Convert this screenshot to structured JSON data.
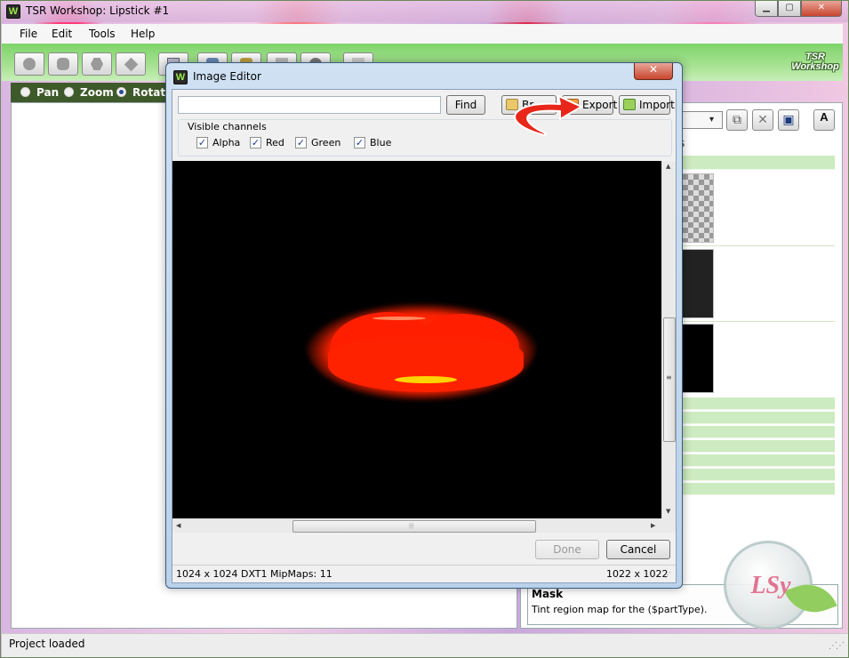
{
  "main_window": {
    "title": "TSR Workshop: Lipstick #1",
    "caption_minimize": "▁",
    "caption_maximize": "▢",
    "caption_close": "✕",
    "app_icon": "W"
  },
  "menu": [
    "File",
    "Edit",
    "Tools",
    "Help"
  ],
  "logo_text": "TSR Workshop",
  "view_modes": [
    {
      "label": "Pan",
      "checked": false
    },
    {
      "label": "Zoom",
      "checked": false
    },
    {
      "label": "Rotate",
      "checked": true
    }
  ],
  "right_panel": {
    "dropdown_arrow": "▾",
    "tab_peek": "s",
    "copy_icon": "⧉",
    "delete_icon": "✕",
    "save_icon": "▣",
    "text_icon": "A",
    "mask_title": "Mask",
    "mask_description": "Tint region map for the ($partType)."
  },
  "status_bar": {
    "text": "Project loaded",
    "grip": "⋰⋰"
  },
  "watermark_text": "LSy",
  "image_editor": {
    "title": "Image Editor",
    "app_icon": "W",
    "close_label": "✕",
    "find_placeholder": "",
    "find_label": "Find",
    "browse_label": "Br",
    "export_label": "Export",
    "import_label": "Import",
    "channels_legend": "Visible channels",
    "channels": [
      {
        "label": "Alpha",
        "checked": true
      },
      {
        "label": "Red",
        "checked": true
      },
      {
        "label": "Green",
        "checked": true
      },
      {
        "label": "Blue",
        "checked": true
      }
    ],
    "check_mark": "✓",
    "done_label": "Done",
    "cancel_label": "Cancel",
    "status_info": "1024 x 1024 DXT1 MipMaps: 11",
    "status_dims": "1022 x 1022",
    "grip": "⋰",
    "scroll_grip_v": "≡",
    "scroll_grip_h": "⦙⦙⦙",
    "arrow_up": "▲",
    "arrow_down": "▼",
    "arrow_left": "◀",
    "arrow_right": "▶"
  },
  "annotation": {
    "color": "#e8261a"
  },
  "icons": {
    "app": "app-icon",
    "export": "export-icon",
    "import": "import-icon",
    "browse": "folder-icon",
    "annotation": "curved-arrow-icon"
  }
}
